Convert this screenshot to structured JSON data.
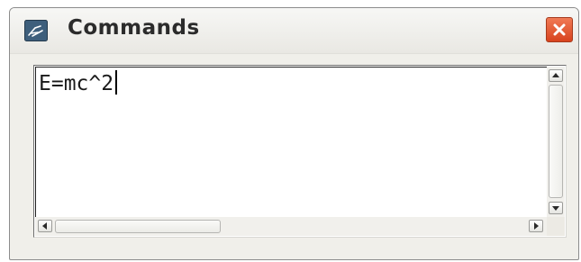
{
  "window": {
    "title": "Commands",
    "close_icon": "close-icon",
    "app_icon": "app-icon"
  },
  "editor": {
    "text": "E=mc^2"
  },
  "colors": {
    "close_button": "#e05a33",
    "title_text": "#2b2b2b"
  }
}
